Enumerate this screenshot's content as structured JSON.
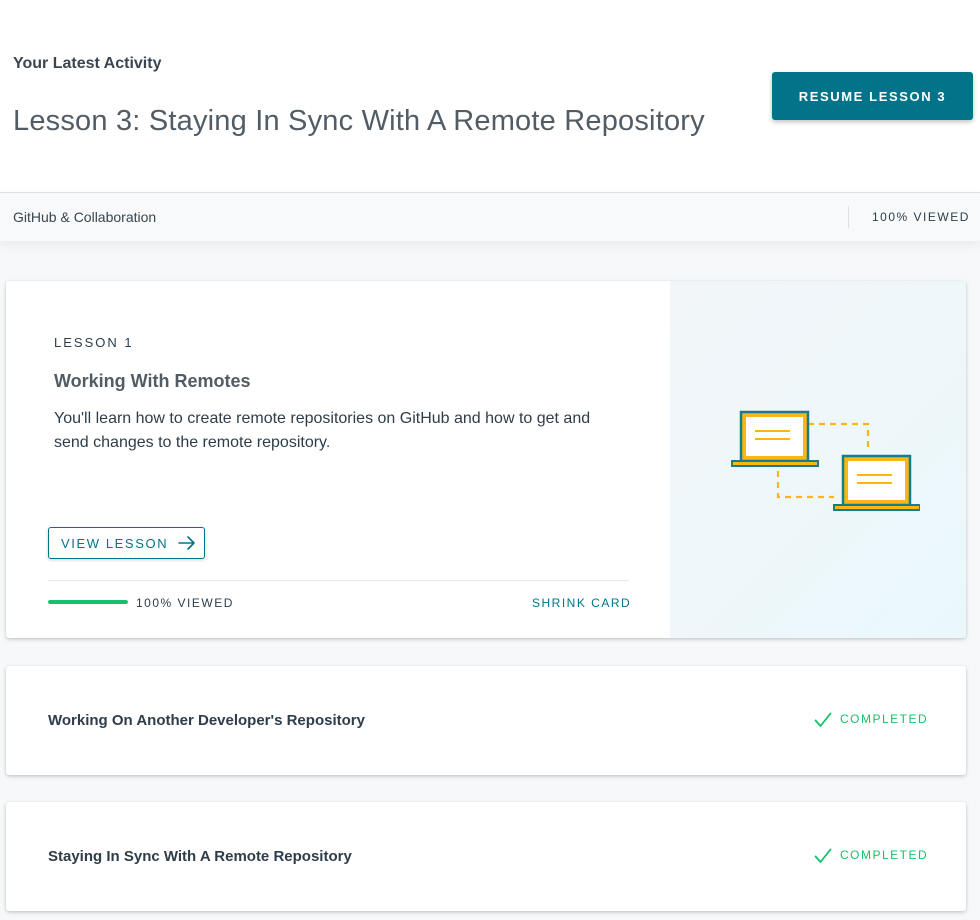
{
  "header": {
    "eyebrow": "Your Latest Activity",
    "lesson_title": "Lesson 3: Staying In Sync With A Remote Repository",
    "resume_label": "RESUME LESSON 3"
  },
  "subbar": {
    "course": "GitHub & Collaboration",
    "viewed": "100% VIEWED"
  },
  "lessons": [
    {
      "label": "LESSON 1",
      "title": "Working With Remotes",
      "description": "You'll learn how to create remote repositories on GitHub and how to get and send changes to the remote repository.",
      "view_label": "VIEW LESSON",
      "progress_fraction": 1.0,
      "viewed": "100% VIEWED",
      "shrink_label": "SHRINK CARD",
      "illustration_icon": "laptops-sync-icon"
    },
    {
      "title": "Working On Another Developer's Repository",
      "status": "COMPLETED",
      "status_icon": "check-icon"
    },
    {
      "title": "Staying In Sync With A Remote Repository",
      "status": "COMPLETED",
      "status_icon": "check-icon"
    }
  ],
  "colors": {
    "accent": "#02748a",
    "success": "#15c26b",
    "illustration_teal": "#147e8c",
    "illustration_yellow": "#fcb614"
  }
}
